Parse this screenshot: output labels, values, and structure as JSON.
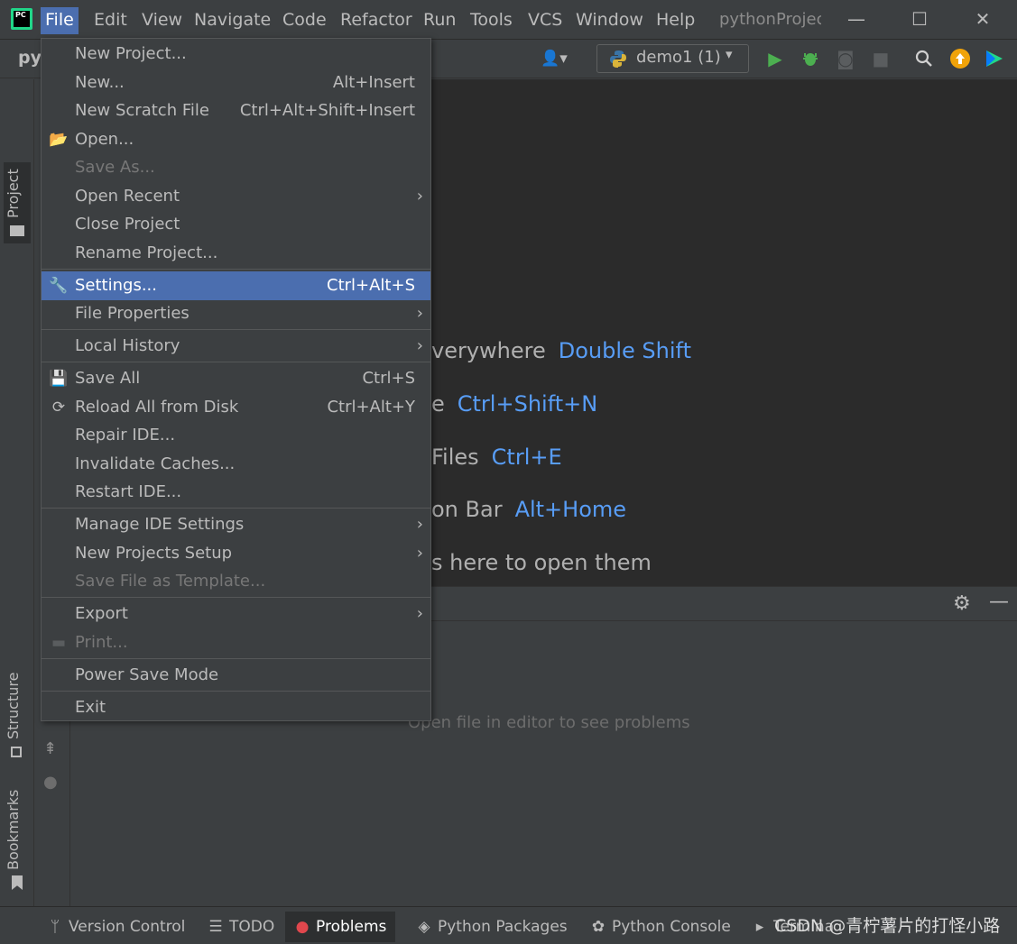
{
  "menubar": {
    "items": [
      "File",
      "Edit",
      "View",
      "Navigate",
      "Code",
      "Refactor",
      "Run",
      "Tools",
      "VCS",
      "Window",
      "Help"
    ],
    "window_title": "pythonProjec",
    "logo_text": "PC"
  },
  "window_controls": {
    "minimize": "—",
    "maximize": "☐",
    "close": "✕"
  },
  "toolbar": {
    "project_crumb": "py",
    "run_config": "demo1 (1)"
  },
  "file_menu": {
    "items": [
      {
        "label": "New Project...",
        "shortcut": "",
        "submenu": false,
        "disabled": false
      },
      {
        "label": "New...",
        "shortcut": "Alt+Insert",
        "submenu": false,
        "disabled": false
      },
      {
        "label": "New Scratch File",
        "shortcut": "Ctrl+Alt+Shift+Insert",
        "submenu": false,
        "disabled": false
      },
      {
        "label": "Open...",
        "shortcut": "",
        "submenu": false,
        "disabled": false
      },
      {
        "label": "Save As...",
        "shortcut": "",
        "submenu": false,
        "disabled": true
      },
      {
        "label": "Open Recent",
        "shortcut": "",
        "submenu": true,
        "disabled": false
      },
      {
        "label": "Close Project",
        "shortcut": "",
        "submenu": false,
        "disabled": false
      },
      {
        "label": "Rename Project...",
        "shortcut": "",
        "submenu": false,
        "disabled": false
      },
      {
        "label": "Settings...",
        "shortcut": "Ctrl+Alt+S",
        "submenu": false,
        "disabled": false,
        "selected": true
      },
      {
        "label": "File Properties",
        "shortcut": "",
        "submenu": true,
        "disabled": false
      },
      {
        "label": "Local History",
        "shortcut": "",
        "submenu": true,
        "disabled": false
      },
      {
        "label": "Save All",
        "shortcut": "Ctrl+S",
        "submenu": false,
        "disabled": false
      },
      {
        "label": "Reload All from Disk",
        "shortcut": "Ctrl+Alt+Y",
        "submenu": false,
        "disabled": false
      },
      {
        "label": "Repair IDE...",
        "shortcut": "",
        "submenu": false,
        "disabled": false
      },
      {
        "label": "Invalidate Caches...",
        "shortcut": "",
        "submenu": false,
        "disabled": false
      },
      {
        "label": "Restart IDE...",
        "shortcut": "",
        "submenu": false,
        "disabled": false
      },
      {
        "label": "Manage IDE Settings",
        "shortcut": "",
        "submenu": true,
        "disabled": false
      },
      {
        "label": "New Projects Setup",
        "shortcut": "",
        "submenu": true,
        "disabled": false
      },
      {
        "label": "Save File as Template...",
        "shortcut": "",
        "submenu": false,
        "disabled": true
      },
      {
        "label": "Export",
        "shortcut": "",
        "submenu": true,
        "disabled": false
      },
      {
        "label": "Print...",
        "shortcut": "",
        "submenu": false,
        "disabled": true
      },
      {
        "label": "Power Save Mode",
        "shortcut": "",
        "submenu": false,
        "disabled": false
      },
      {
        "label": "Exit",
        "shortcut": "",
        "submenu": false,
        "disabled": false
      }
    ],
    "submenu_glyph": "›"
  },
  "editor_hints": [
    {
      "text": "verywhere",
      "shortcut": "Double Shift"
    },
    {
      "text": "e",
      "shortcut": "Ctrl+Shift+N"
    },
    {
      "text": "Files",
      "shortcut": "Ctrl+E"
    },
    {
      "text": "on Bar",
      "shortcut": "Alt+Home"
    },
    {
      "text": "s here to open them",
      "shortcut": ""
    }
  ],
  "problems": {
    "empty_text": "Open file in editor to see problems"
  },
  "left_strip": {
    "project": "Project",
    "structure": "Structure",
    "bookmarks": "Bookmarks"
  },
  "bottom_bar": {
    "tabs": [
      {
        "label": "Version Control",
        "icon": "branch-icon"
      },
      {
        "label": "TODO",
        "icon": "list-icon"
      },
      {
        "label": "Problems",
        "icon": "error-icon",
        "active": true
      },
      {
        "label": "Python Packages",
        "icon": "layers-icon"
      },
      {
        "label": "Python Console",
        "icon": "python-icon"
      },
      {
        "label": "Termina",
        "icon": "terminal-icon"
      }
    ]
  },
  "watermark": "CSDN @青柠薯片的打怪小路",
  "colors": {
    "accent": "#4b6eaf",
    "shortcut_blue": "#589df6",
    "background": "#3c3f41",
    "editor": "#2b2b2b"
  }
}
